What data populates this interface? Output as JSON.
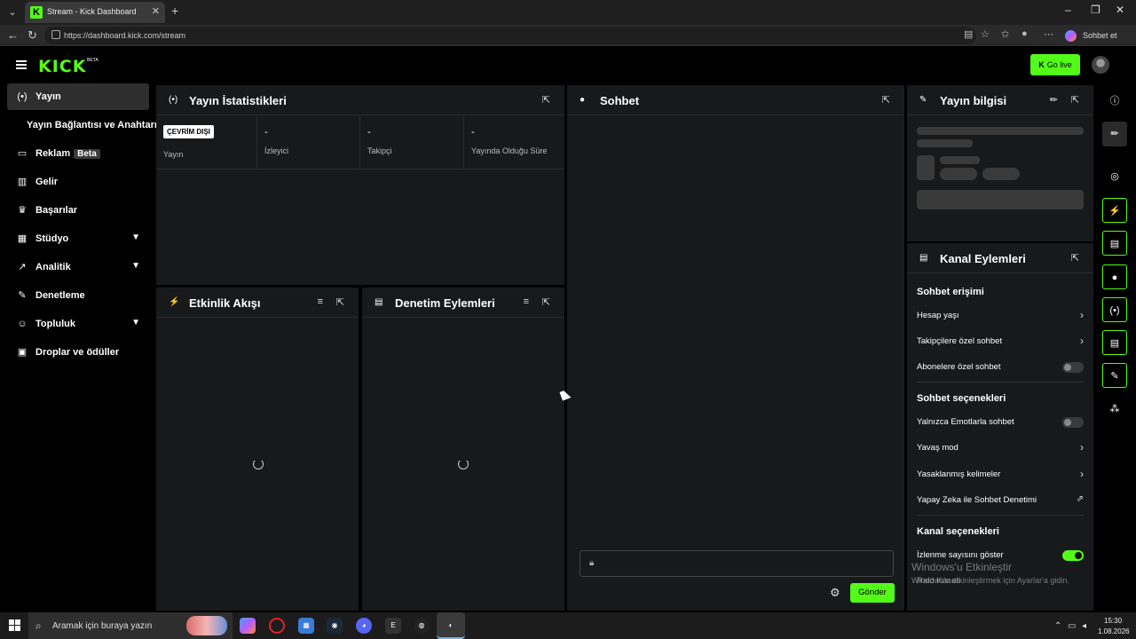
{
  "browser": {
    "tab_title": "Stream - Kick Dashboard",
    "url": "https://dashboard.kick.com/stream",
    "copilot_label": "Sohbet et"
  },
  "header": {
    "logo_text": "KICK",
    "logo_sup": "BETA",
    "golive_label": "Go live"
  },
  "sidebar": {
    "items": [
      {
        "label": "Yayın"
      },
      {
        "label": "Yayın Bağlantısı ve Anahtarı"
      },
      {
        "label": "Reklam",
        "badge": "Beta"
      },
      {
        "label": "Gelir"
      },
      {
        "label": "Başarılar"
      },
      {
        "label": "Stüdyo"
      },
      {
        "label": "Analitik"
      },
      {
        "label": "Denetleme"
      },
      {
        "label": "Topluluk"
      },
      {
        "label": "Droplar ve ödüller"
      }
    ]
  },
  "stats": {
    "title": "Yayın İstatistikleri",
    "offline_badge": "ÇEVRİM DIŞI",
    "cells": [
      {
        "value": "",
        "label": "Yayın"
      },
      {
        "value": "-",
        "label": "İzleyici"
      },
      {
        "value": "-",
        "label": "Takipçi"
      },
      {
        "value": "-",
        "label": "Yayında Olduğu Süre"
      }
    ]
  },
  "activity": {
    "title": "Etkinlik Akışı"
  },
  "moderation": {
    "title": "Denetim Eylemleri"
  },
  "chat": {
    "title": "Sohbet",
    "send_label": "Gönder"
  },
  "stream_info": {
    "title": "Yayın bilgisi"
  },
  "channel_actions": {
    "title": "Kanal Eylemleri",
    "section_chat_access": "Sohbet erişimi",
    "account_age": "Hesap yaşı",
    "followers_only": "Takipçilere özel sohbet",
    "subscribers_only": "Abonelere özel sohbet",
    "section_chat_options": "Sohbet seçenekleri",
    "emotes_only": "Yalnızca Emotlarla sohbet",
    "slow_mode": "Yavaş mod",
    "banned_words": "Yasaklanmış kelimeler",
    "ai_moderation": "Yapay Zeka ile Sohbet Denetimi",
    "section_channel_options": "Kanal seçenekleri",
    "show_viewer_count": "İzlenme sayısını göster",
    "raid_channel": "Raid Kanalı",
    "toggles": {
      "subscribers_only": false,
      "emotes_only": false,
      "show_viewer_count": true
    }
  },
  "watermark": {
    "line1": "Windows'u Etkinleştir",
    "line2": "Windows'u etkinleştirmek için Ayarlar'a gidin."
  },
  "taskbar": {
    "search_placeholder": "Aramak için buraya yazın",
    "time": "15:30",
    "date": "1.08.2026"
  },
  "colors": {
    "accent": "#53fc18",
    "panel": "#18191a"
  }
}
